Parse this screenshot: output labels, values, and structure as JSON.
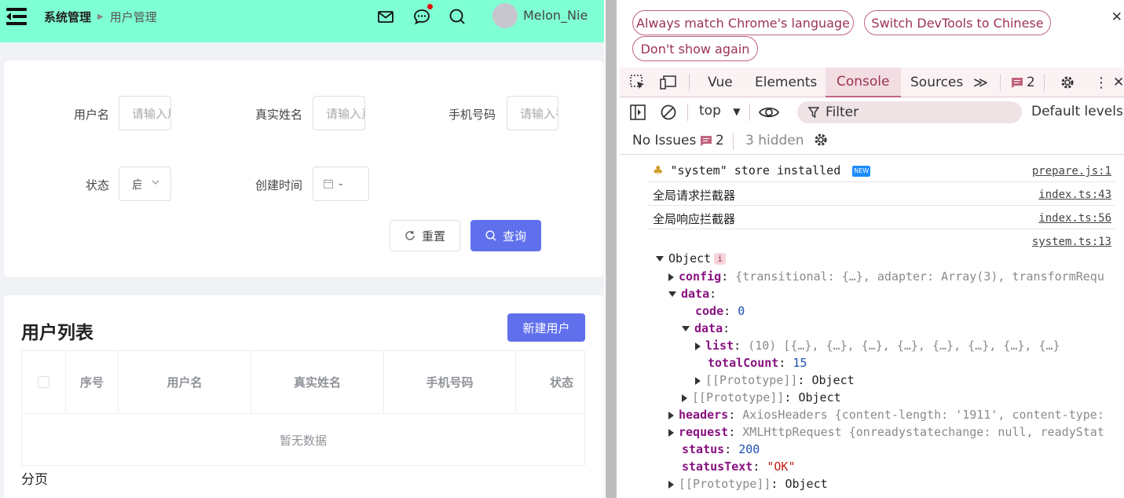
{
  "app": {
    "breadcrumb": [
      "系统管理",
      "用户管理"
    ],
    "user": {
      "name": "Melon_Nie"
    },
    "search_form": {
      "username_label": "用户名",
      "username_placeholder": "请输入用户名",
      "realname_label": "真实姓名",
      "realname_placeholder": "请输入真实姓名",
      "phone_label": "手机号码",
      "phone_placeholder": "请输入手机号码",
      "status_label": "状态",
      "status_value": "启用",
      "created_label": "创建时间",
      "date_separator": "-",
      "reset_label": "重置",
      "query_label": "查询"
    },
    "list": {
      "title": "用户列表",
      "new_user_label": "新建用户",
      "columns": [
        "序号",
        "用户名",
        "真实姓名",
        "手机号码",
        "状态"
      ],
      "empty_text": "暂无数据",
      "pager_label": "分页"
    }
  },
  "devtools": {
    "banner": {
      "match_lang": "Always match Chrome's language",
      "switch_chinese": "Switch DevTools to Chinese",
      "dont_show": "Don't show again"
    },
    "tabs": [
      "Vue",
      "Elements",
      "Console",
      "Sources"
    ],
    "active_tab": "Console",
    "issues_count": "2",
    "context": "top",
    "filter_placeholder": "Filter",
    "levels": "Default levels",
    "no_issues": "No Issues",
    "issues_badge": "2",
    "hidden": "3 hidden",
    "messages": [
      {
        "text": "\"system\" store installed",
        "source": "prepare.js:1"
      },
      {
        "text": "全局请求拦截器",
        "source": "index.ts:43"
      },
      {
        "text": "全局响应拦截器",
        "source": "index.ts:56"
      },
      {
        "text": "",
        "source": "system.ts:13"
      }
    ],
    "object_tree": {
      "root": "Object",
      "config_key": "config",
      "config_preview": "{transitional: {…}, adapter: Array(3), transformRequ",
      "data_key": "data",
      "code_key": "code",
      "code_value": "0",
      "inner_data_key": "data",
      "list_key": "list",
      "list_preview": "(10) [{…}, {…}, {…}, {…}, {…}, {…}, {…}, {…}",
      "total_key": "totalCount",
      "total_value": "15",
      "proto": "[[Prototype]]",
      "proto_value": "Object",
      "headers_key": "headers",
      "headers_type": "AxiosHeaders",
      "headers_preview": "{content-length: '1911', content-type:",
      "request_key": "request",
      "request_type": "XMLHttpRequest",
      "request_preview": "{onreadystatechange: null, readyStat",
      "status_key": "status",
      "status_value": "200",
      "statusText_key": "statusText",
      "statusText_value": "\"OK\""
    }
  }
}
